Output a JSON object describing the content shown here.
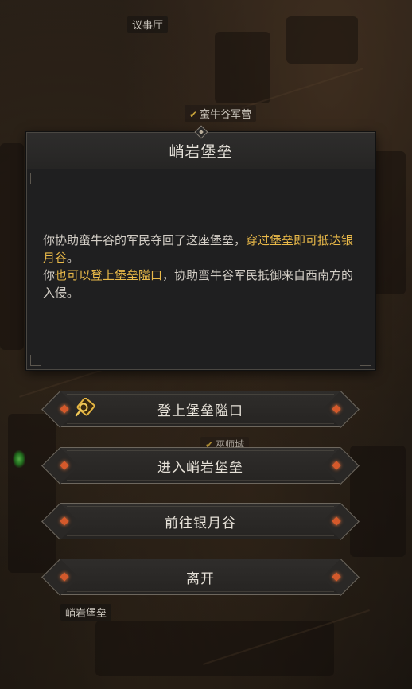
{
  "map": {
    "labels": {
      "council_hall": "议事厅",
      "valley_camp": "蛮牛谷军营",
      "partial_label": "巫师城",
      "fortress": "峭岩堡垒"
    }
  },
  "dialog": {
    "title": "峭岩堡垒",
    "line1_normal": "你协助蛮牛谷的军民夺回了这座堡垒，",
    "line1_highlight": "穿过堡垒即可抵达银月谷",
    "line1_end": "。",
    "line2_start": "你",
    "line2_highlight": "也可以登上堡垒隘口",
    "line2_end": "，协助蛮牛谷军民抵御来自西南方的入侵。"
  },
  "options": [
    {
      "label": "登上堡垒隘口",
      "icon": "quest-icon"
    },
    {
      "label": "进入峭岩堡垒"
    },
    {
      "label": "前往银月谷"
    },
    {
      "label": "离开"
    }
  ],
  "colors": {
    "highlight": "#e9b949",
    "accent_diamond": "#d4592b",
    "check": "#c9a43a"
  }
}
